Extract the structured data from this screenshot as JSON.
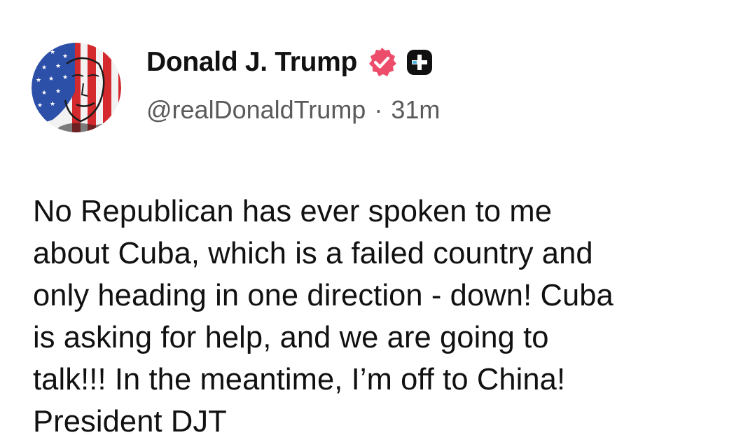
{
  "post": {
    "author": {
      "display_name": "Donald J. Trump",
      "handle": "@realDonaldTrump",
      "avatar_icon": "american-flag-portrait-avatar",
      "verified_icon": "verified-badge-icon",
      "verified_color": "#ec4d6b",
      "extra_badge_icon": "plus-badge-icon",
      "extra_badge_color": "#111111"
    },
    "separator": "·",
    "timestamp": "31m",
    "body_lines": [
      "No Republican has ever spoken to me",
      "about Cuba, which is a failed country and",
      "only heading in one direction - down! Cuba",
      "is asking for help, and we are going to",
      "talk!!! In the meantime, I’m off to China!",
      "President DJT"
    ]
  }
}
